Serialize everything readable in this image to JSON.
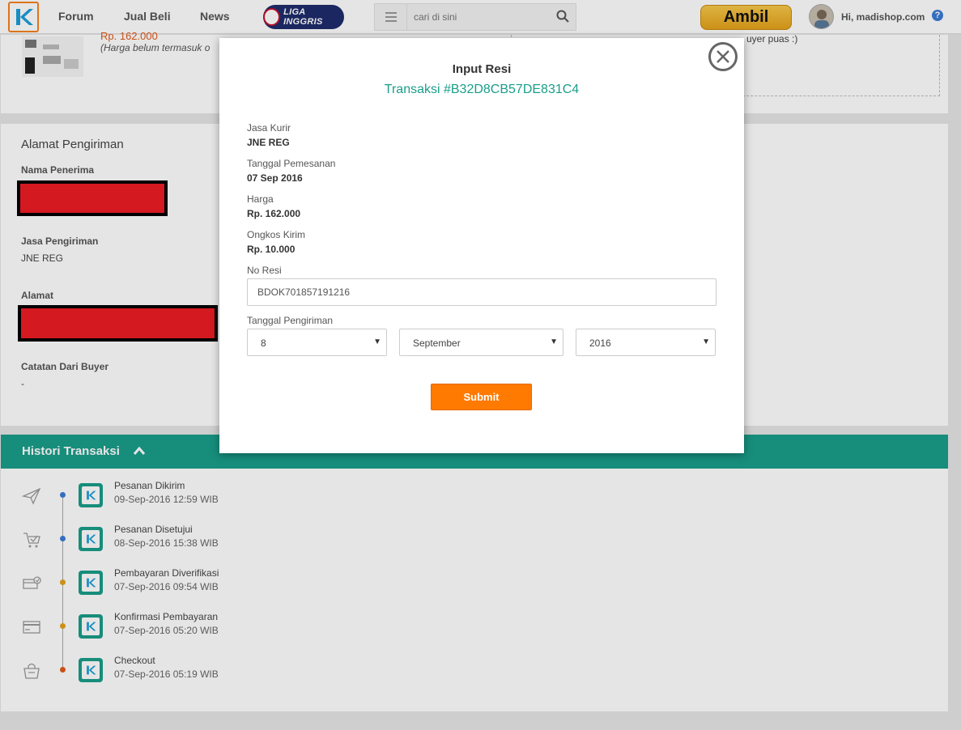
{
  "nav": {
    "links": [
      "Forum",
      "Jual Beli",
      "News"
    ],
    "liga_label": "LIGA INGGRIS",
    "search_placeholder": "cari di sini",
    "ambil_label": "Ambil",
    "greeting": "Hi, madishop.com",
    "help_label": "?"
  },
  "product": {
    "price_partial": "Rp. 162.000",
    "note_partial": "(Harga belum termasuk o",
    "right_note_partial": "uyer puas :)"
  },
  "address": {
    "section_title": "Alamat Pengiriman",
    "recipient_label": "Nama Penerima",
    "shipping_label": "Jasa Pengiriman",
    "shipping_value": "JNE REG",
    "address_label": "Alamat",
    "notes_label": "Catatan Dari Buyer",
    "notes_value": "-"
  },
  "history": {
    "title": "Histori Transaksi",
    "items": [
      {
        "title": "Pesanan Dikirim",
        "date": "09-Sep-2016 12:59 WIB",
        "icon": "paper-plane-icon",
        "dot_color": "#3a7bd5"
      },
      {
        "title": "Pesanan Disetujui",
        "date": "08-Sep-2016 15:38 WIB",
        "icon": "cart-check-icon",
        "dot_color": "#3a7bd5"
      },
      {
        "title": "Pembayaran Diverifikasi",
        "date": "07-Sep-2016 09:54 WIB",
        "icon": "payment-verified-icon",
        "dot_color": "#e3a21a"
      },
      {
        "title": "Konfirmasi Pembayaran",
        "date": "07-Sep-2016 05:20 WIB",
        "icon": "credit-card-icon",
        "dot_color": "#e3a21a"
      },
      {
        "title": "Checkout",
        "date": "07-Sep-2016 05:19 WIB",
        "icon": "shopping-bag-icon",
        "dot_color": "#e05a1a"
      }
    ]
  },
  "modal": {
    "title": "Input Resi",
    "transaction": "Transaksi #B32D8CB57DE831C4",
    "courier_label": "Jasa Kurir",
    "courier_value": "JNE REG",
    "order_date_label": "Tanggal Pemesanan",
    "order_date_value": "07 Sep 2016",
    "price_label": "Harga",
    "price_value": "Rp. 162.000",
    "shipping_cost_label": "Ongkos Kirim",
    "shipping_cost_value": "Rp. 10.000",
    "resi_label": "No Resi",
    "resi_value": "BDOK701857191216",
    "ship_date_label": "Tanggal Pengiriman",
    "day": "8",
    "month": "September",
    "year": "2016",
    "submit_label": "Submit"
  },
  "colors": {
    "accent_teal": "#1a9e8a",
    "submit_orange": "#ff7a00",
    "logo_orange": "#f58220"
  }
}
